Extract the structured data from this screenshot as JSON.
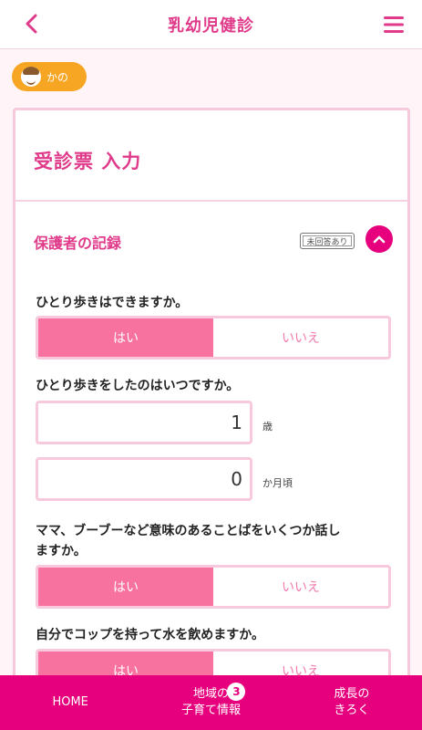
{
  "header": {
    "title": "乳幼児健診",
    "back_icon": "chevron-left-icon",
    "menu_icon": "hamburger-menu-icon"
  },
  "child": {
    "name": "かの"
  },
  "card": {
    "title": "受診票 入力",
    "section_title": "保護者の記録",
    "unanswered_badge": "未回答あり"
  },
  "questions": [
    {
      "text": "ひとり歩きはできますか。",
      "yes": "はい",
      "no": "いいえ",
      "selected": "yes"
    },
    {
      "text": "ひとり歩きをしたのはいつですか。",
      "age_years_value": "1",
      "age_years_unit": "歳",
      "age_months_value": "0",
      "age_months_unit": "か月頃"
    },
    {
      "text_line1": "ママ、ブーブーなど意味のあることばをいくつか話し",
      "text_line2": "ますか。",
      "yes": "はい",
      "no": "いいえ",
      "selected": "yes"
    },
    {
      "text": "自分でコップを持って水を飲めますか。",
      "yes": "はい",
      "no": "いいえ",
      "selected": "yes"
    }
  ],
  "tabbar": {
    "home": "HOME",
    "local_line1": "地域の",
    "local_line2": "子育て情報",
    "local_count": "3",
    "growth_line1": "成長の",
    "growth_line2": "きろく"
  },
  "colors": {
    "accent": "#e6007e",
    "title_pink": "#e03a8a",
    "selected_option": "#f8729f",
    "border_pink": "#f8c9dc",
    "badge_orange": "#f6a623"
  }
}
